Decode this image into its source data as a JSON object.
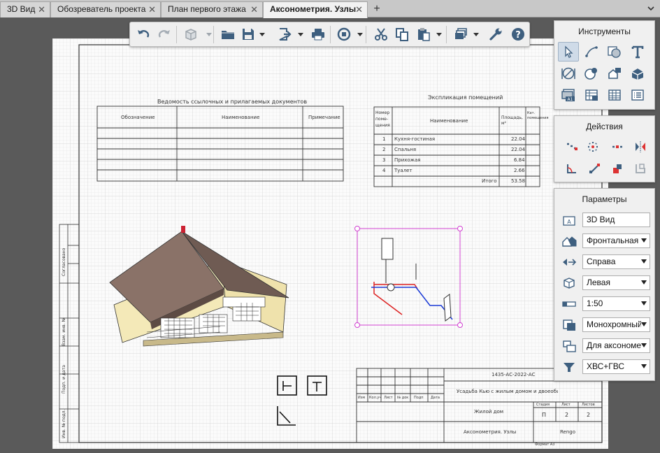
{
  "tabs": [
    {
      "label": "3D Вид",
      "close": "✕"
    },
    {
      "label": "Обозреватель проекта",
      "close": "✕"
    },
    {
      "label": "План первого этажа",
      "close": "✕"
    },
    {
      "label": "Аксонометрия. Узлы",
      "close": "✕"
    }
  ],
  "tab_add": "+",
  "toolbar": {
    "icons": [
      "undo-icon",
      "redo-icon",
      "3d-box-icon",
      "folder-open-icon",
      "save-icon",
      "export-icon",
      "print-icon",
      "sync-icon",
      "cut-icon",
      "copy-icon",
      "paste-icon",
      "layers-icon",
      "wrench-icon",
      "help-icon"
    ]
  },
  "panels": {
    "tools": {
      "title": "Инструменты",
      "icons": [
        "pointer-icon",
        "line-icon",
        "hatch-icon",
        "text-icon",
        "dimension-icon",
        "section-marker-icon",
        "node-view-icon",
        "3d-view-icon",
        "layout-icon",
        "table-icon",
        "schedule-icon",
        "list-icon"
      ]
    },
    "actions": {
      "title": "Действия",
      "icons": [
        "move-icon",
        "rotate-icon",
        "copy-array-icon",
        "mirror-icon",
        "offset-icon",
        "scale-icon",
        "stretch-icon",
        "match-icon"
      ]
    },
    "params": {
      "title": "Параметры",
      "rows": [
        {
          "icon": "view-name-icon",
          "value": "3D Вид",
          "dropdown": false
        },
        {
          "icon": "house-view-icon",
          "value": "Фронтальная",
          "dropdown": true
        },
        {
          "icon": "direction-icon",
          "value": "Справа",
          "dropdown": true
        },
        {
          "icon": "cube-side-icon",
          "value": "Левая",
          "dropdown": true
        },
        {
          "icon": "scale-ruler-icon",
          "value": "1:50",
          "dropdown": true
        },
        {
          "icon": "style-icon",
          "value": "Монохромный",
          "dropdown": true
        },
        {
          "icon": "frame-icon",
          "value": "Для аксонометрии",
          "dropdown": true
        },
        {
          "icon": "filter-icon",
          "value": "ХВС+ГВС",
          "dropdown": true
        }
      ]
    }
  },
  "drawing": {
    "ref_docs": {
      "title": "Ведомость ссылочных и прилагаемых документов",
      "headers": [
        "Обозначение",
        "Наименование",
        "Примечание"
      ]
    },
    "rooms": {
      "title": "Экспликация помещений",
      "headers": [
        "Номер поме-щения",
        "Наименование",
        "Площадь, м²",
        "Кат. помещения"
      ],
      "rows": [
        {
          "num": "1",
          "name": "Кухня-гостиная",
          "area": "22.04"
        },
        {
          "num": "2",
          "name": "Спальня",
          "area": "22.04"
        },
        {
          "num": "3",
          "name": "Прихожая",
          "area": "6.84"
        },
        {
          "num": "4",
          "name": "Туалет",
          "area": "2.66"
        }
      ],
      "total_label": "Итого",
      "total": "53.58"
    },
    "side_stamp": [
      "Согласовано",
      "Взам. инв. №",
      "Подп. и дата",
      "Инв. № подл."
    ],
    "title_block": {
      "code": "1435-АС-2022-АС",
      "project": "Усадьба Кью с жилым домом и двоеобым ...",
      "object": "Жилой дом",
      "sheet_name": "Аксонометрия. Узлы",
      "company": "Rengo",
      "col_headers": [
        "Изм",
        "Кол.уч",
        "Лист",
        "№ док",
        "Подп",
        "Дата"
      ],
      "stage_headers": [
        "Стадия",
        "Лист",
        "Листов"
      ],
      "stage": "П",
      "sheet": "2",
      "sheets": "2",
      "format": "Формат А3"
    }
  }
}
